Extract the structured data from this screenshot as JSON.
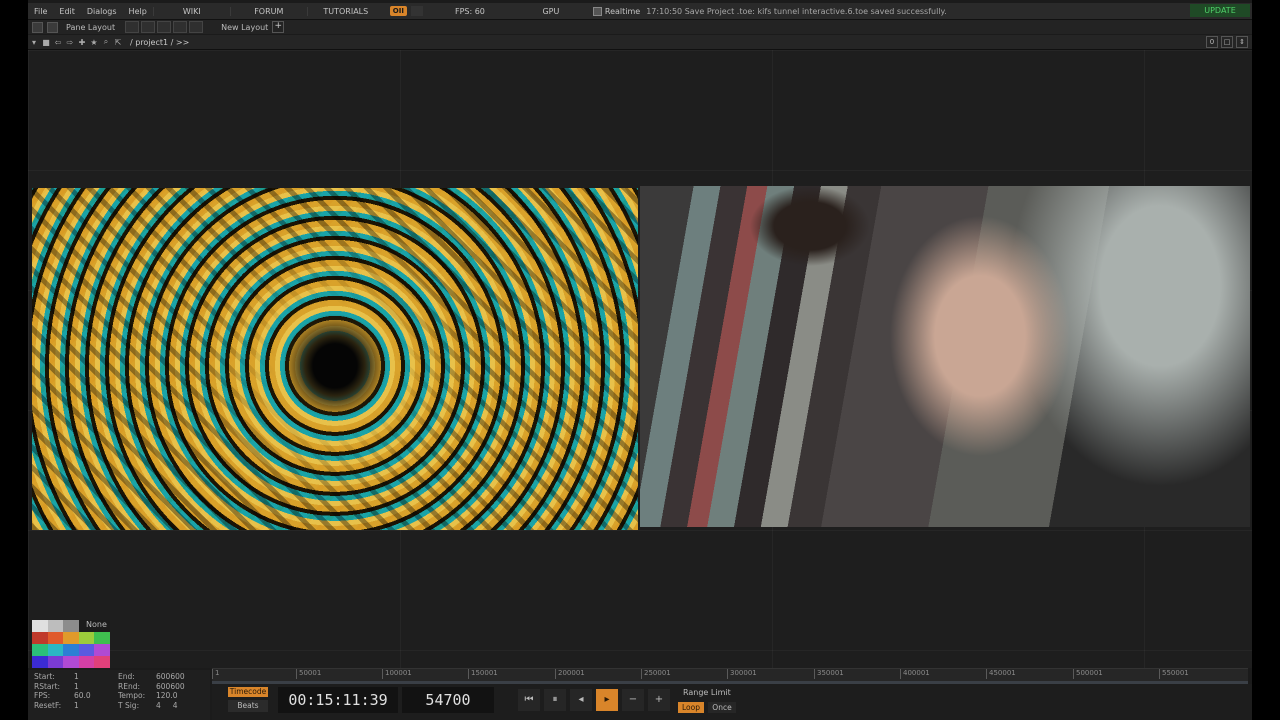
{
  "menu": {
    "file": "File",
    "edit": "Edit",
    "dialogs": "Dialogs",
    "help": "Help",
    "wiki": "WIKI",
    "forum": "FORUM",
    "tutorials": "TUTORIALS",
    "oii": "OII",
    "fps": "FPS: 60",
    "gpu": "GPU",
    "realtime": "Realtime",
    "status": "17:10:50 Save Project .toe: kifs tunnel interactive.6.toe saved successfully.",
    "update": "UPDATE"
  },
  "pane_bar": {
    "pane_layout": "Pane Layout",
    "new_layout": "New Layout",
    "plus": "+"
  },
  "path_bar": {
    "path": "/ project1 / >>",
    "right_value": "0"
  },
  "palette": {
    "none_label": "None",
    "row1": [
      "#e0e0e0",
      "#bdbdbd",
      "#8c8c8c",
      "#555555",
      "#2e2e2e"
    ],
    "row2": [
      "#c0392b",
      "#e05a2b",
      "#e09a2b",
      "#9ccc3b",
      "#3fbf4f"
    ],
    "row3": [
      "#2bbf7a",
      "#2bb7c4",
      "#2b7fd4",
      "#5a5ae0",
      "#b04ad4"
    ],
    "row4": [
      "#d43fa6",
      "#e0407a",
      "#7a3bd4",
      "#3b2bd4",
      "#d42b5a"
    ]
  },
  "time_info": {
    "start_label": "Start:",
    "start": "1",
    "rstart_label": "RStart:",
    "rstart": "1",
    "fps_label": "FPS:",
    "fps": "60.0",
    "resetf_label": "ResetF:",
    "resetf": "1",
    "end_label": "End:",
    "end": "600600",
    "rend_label": "REnd:",
    "rend": "600600",
    "tempo_label": "Tempo:",
    "tempo": "120.0",
    "tsig_label": "T Sig:",
    "tsig_a": "4",
    "tsig_b": "4"
  },
  "ruler_ticks": [
    "1",
    "50001",
    "100001",
    "150001",
    "200001",
    "250001",
    "300001",
    "350001",
    "400001",
    "450001",
    "500001",
    "550001"
  ],
  "transport": {
    "timecode": "Timecode",
    "beats": "Beats",
    "time_display": "00:15:11:39",
    "frame_display": "54700",
    "range_limit": "Range Limit",
    "loop": "Loop",
    "once": "Once"
  },
  "colors": {
    "accent": "#d9852a",
    "update_bg": "#1f4a26",
    "update_text": "#4fd26a"
  }
}
